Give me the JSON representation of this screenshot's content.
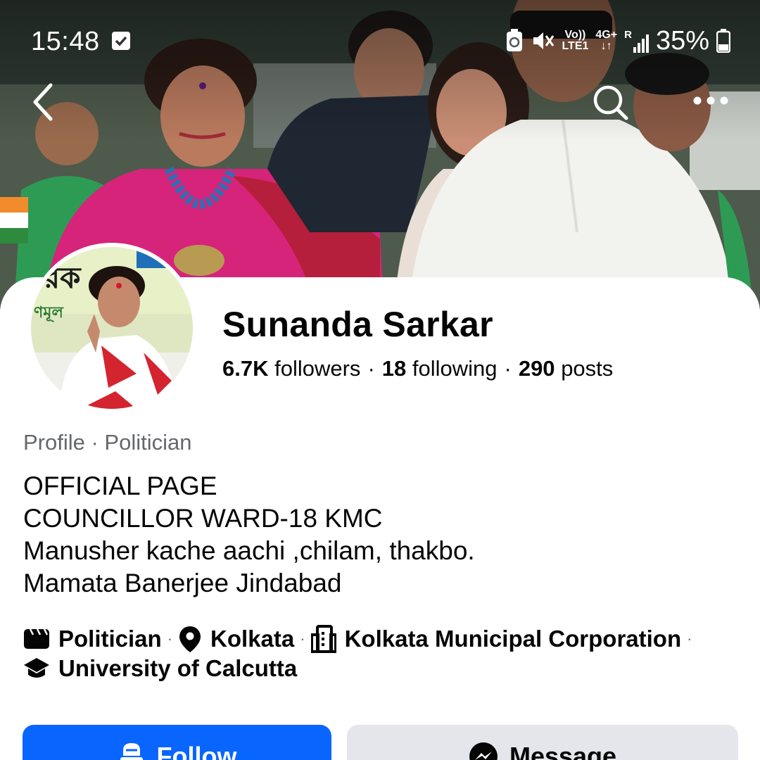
{
  "status_bar": {
    "time": "15:48",
    "network_top": "Vo))",
    "network_bottom": "LTE1",
    "gen": "4G+",
    "roaming": "R",
    "battery": "35%"
  },
  "profile": {
    "name": "Sunanda Sarkar",
    "followers_count": "6.7K",
    "followers_label": "followers",
    "following_count": "18",
    "following_label": "following",
    "posts_count": "290",
    "posts_label": "posts",
    "category_line": "Profile · Politician",
    "bio": [
      "OFFICIAL PAGE",
      "COUNCILLOR WARD-18 KMC",
      "Manusher kache aachi ,chilam, thakbo.",
      "Mamata Banerjee Jindabad"
    ],
    "details": {
      "category": "Politician",
      "location": "Kolkata",
      "workplace": "Kolkata Municipal Corporation",
      "education": "University of Calcutta"
    }
  },
  "actions": {
    "follow_label": "Follow",
    "message_label": "Message"
  },
  "icons": [
    "back-icon",
    "search-icon",
    "more-icon",
    "category-icon",
    "location-pin-icon",
    "building-icon",
    "graduation-cap-icon",
    "follow-icon",
    "messenger-icon"
  ],
  "colors": {
    "primary": "#0866ff",
    "secondary_button": "#e4e6eb",
    "muted_text": "#65676b"
  }
}
